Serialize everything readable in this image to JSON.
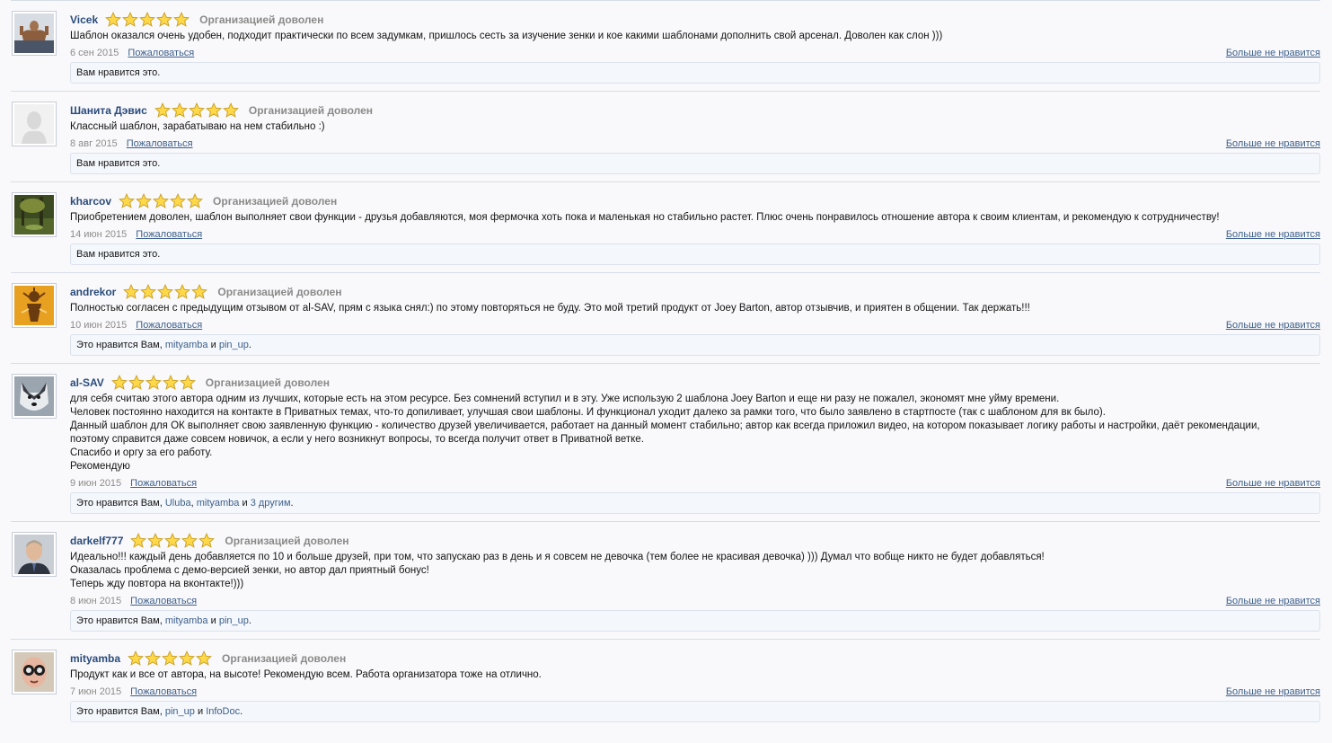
{
  "labels": {
    "rating_text": "Организацией доволен",
    "report": "Пожаловаться",
    "unlike": "Больше не нравится",
    "and": "и",
    "likes_suffix": "."
  },
  "colors": {
    "username": "#2a4b7c",
    "link": "#3d5f8c",
    "star_fill": "#ffd84a",
    "star_stroke": "#c9a227"
  },
  "reviews": [
    {
      "user": "Vicek",
      "avatar_icon": "bodybuilder-avatar",
      "stars": 5,
      "lines": [
        "Шаблон оказался очень удобен, подходит практически по всем задумкам, пришлось сесть за изучение зенки и кое какими шаблонами дополнить свой арсенал. Доволен как слон )))"
      ],
      "date": "6 сен 2015",
      "likes_prefix": "Вам нравится это.",
      "likers": [],
      "likers_extra": ""
    },
    {
      "user": "Шанита Дэвис",
      "avatar_icon": "default-avatar",
      "stars": 5,
      "lines": [
        "Классный шаблон, зарабатываю на нем стабильно :)"
      ],
      "date": "8 авг 2015",
      "likes_prefix": "Вам нравится это.",
      "likers": [],
      "likers_extra": ""
    },
    {
      "user": "kharcov",
      "avatar_icon": "forest-avatar",
      "stars": 5,
      "lines": [
        "Приобретением доволен, шаблон выполняет свои функции - друзья добавляются, моя фермочка хоть пока и маленькая но стабильно растет. Плюс очень понравилось отношение автора к своим клиентам, и рекомендую к сотрудничеству!"
      ],
      "date": "14 июн 2015",
      "likes_prefix": "Вам нравится это.",
      "likers": [],
      "likers_extra": ""
    },
    {
      "user": "andrekor",
      "avatar_icon": "tribal-art-avatar",
      "stars": 5,
      "lines": [
        "Полностью согласен с предыдущим отзывом от al-SAV, прям с языка снял:) по этому повторяться не буду. Это мой третий продукт от Joey Barton, автор отзывчив, и приятен в общении. Так держать!!!"
      ],
      "date": "10 июн 2015",
      "likes_prefix": "Это нравится Вам,",
      "likers": [
        "mityamba",
        "pin_up"
      ],
      "likers_extra": ""
    },
    {
      "user": "al-SAV",
      "avatar_icon": "husky-avatar",
      "stars": 5,
      "lines": [
        "для себя считаю этого автора одним из лучших, которые есть на этом ресурсе. Без сомнений вступил и в эту. Уже использую 2 шаблона Joey Barton и еще ни разу не пожалел, экономят мне уйму времени.",
        "Человек постоянно находится на контакте в Приватных темах, что-то допиливает, улучшая свои шаблоны. И функционал уходит далеко за рамки того, что было заявлено в стартпосте (так с шаблоном для вк было).",
        "Данный шаблон для ОК выполняет свою заявленную функцию - количество друзей увеличивается, работает на данный момент стабильно; автор как всегда приложил видео, на котором показывает логику работы и настройки, даёт рекомендации,",
        "поэтому справится даже совсем новичок, а если у него возникнут вопросы, то всегда получит ответ в Приватной ветке.",
        "Спасибо и оргу за его работу.",
        "Рекомендую"
      ],
      "date": "9 июн 2015",
      "likes_prefix": "Это нравится Вам,",
      "likers": [
        "Uluba",
        "mityamba"
      ],
      "likers_extra": "3 другим"
    },
    {
      "user": "darkelf777",
      "avatar_icon": "portrait-avatar",
      "stars": 5,
      "lines": [
        "Идеально!!! каждый день добавляется по 10 и больше друзей, при том, что запускаю раз в день и я совсем не девочка (тем более не красивая девочка) ))) Думал что вобще никто не будет добавляться!",
        "Оказалась проблема с демо-версией зенки, но автор дал приятный бонус!",
        "Теперь жду повтора на вконтакте!)))"
      ],
      "date": "8 июн 2015",
      "likes_prefix": "Это нравится Вам,",
      "likers": [
        "mityamba",
        "pin_up"
      ],
      "likers_extra": ""
    },
    {
      "user": "mityamba",
      "avatar_icon": "glasses-avatar",
      "stars": 5,
      "lines": [
        "Продукт как и все от автора, на высоте! Рекомендую всем. Работа организатора тоже на отлично."
      ],
      "date": "7 июн 2015",
      "likes_prefix": "Это нравится Вам,",
      "likers": [
        "pin_up",
        "InfoDoc"
      ],
      "likers_extra": ""
    }
  ]
}
